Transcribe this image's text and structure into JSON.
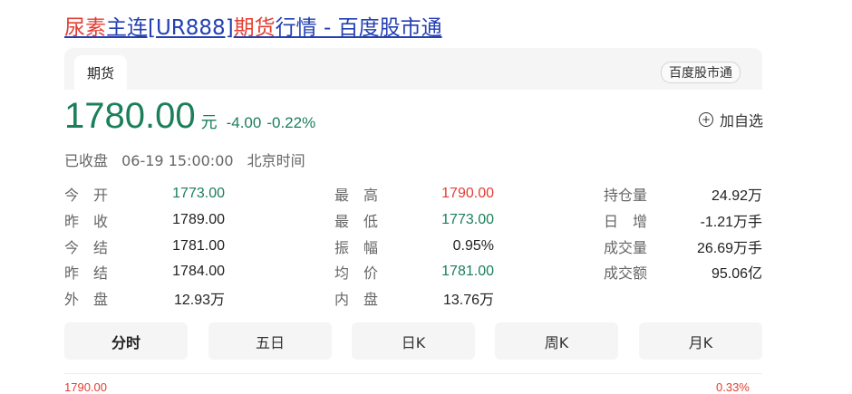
{
  "title": {
    "part1": "尿素",
    "part2": "主连[UR888]",
    "part3": "期货",
    "part4": "行情 - 百度股市通"
  },
  "tabbar": {
    "active_tab": "期货",
    "source_badge": "百度股市通"
  },
  "quote": {
    "price": "1780.00",
    "unit": "元",
    "change": "-4.00",
    "change_pct": "-0.22%",
    "watch_label": "加自选"
  },
  "status": {
    "state": "已收盘",
    "datetime": "06-19 15:00:00",
    "timezone": "北京时间"
  },
  "stats": {
    "col1": [
      {
        "label": "今　开",
        "value": "1773.00"
      },
      {
        "label": "昨　收",
        "value": "1789.00"
      },
      {
        "label": "今　结",
        "value": "1781.00"
      },
      {
        "label": "昨　结",
        "value": "1784.00"
      },
      {
        "label": "外　盘",
        "value": "12.93万"
      }
    ],
    "col2": [
      {
        "label": "最　高",
        "value": "1790.00"
      },
      {
        "label": "最　低",
        "value": "1773.00"
      },
      {
        "label": "振　幅",
        "value": "0.95%"
      },
      {
        "label": "均　价",
        "value": "1781.00"
      },
      {
        "label": "内　盘",
        "value": "13.76万"
      }
    ],
    "col3": [
      {
        "label": "持仓量",
        "value": "24.92万"
      },
      {
        "label": "日　增",
        "value": "-1.21万手"
      },
      {
        "label": "成交量",
        "value": "26.69万手"
      },
      {
        "label": "成交额",
        "value": "95.06亿"
      }
    ]
  },
  "period_tabs": [
    "分时",
    "五日",
    "日K",
    "周K",
    "月K"
  ],
  "chart_peek": {
    "left": "1790.00",
    "right": "0.33%"
  },
  "colors": {
    "down": "#1b7f5a",
    "up": "#e33e33",
    "link": "#2440b3"
  }
}
